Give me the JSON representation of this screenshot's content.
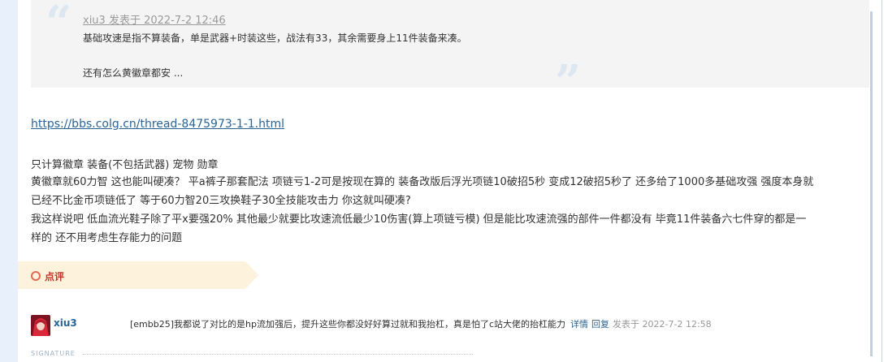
{
  "quote": {
    "author_line": "xiu3 发表于 2022-7-2 12:46",
    "lines": [
      "基础攻速是指不算装备，单是武器+时装这些，战法有33，其余需要身上11件装备来凑。",
      "还有怎么黄徽章都安 ..."
    ]
  },
  "post": {
    "link": "https://bbs.colg.cn/thread-8475973-1-1.html",
    "lines": [
      "只计算徽章 装备(不包括武器) 宠物 勋章",
      "黄徽章就60力智 这也能叫硬凑？ 平a裤子那套配法 项链亏1-2可是按现在算的 装备改版后浮光项链10破招5秒 变成12破招5秒了 还多给了1000多基础攻强 强度本身就",
      "已经不比金币项链低了 等于60力智20三攻换鞋子30全技能攻击力 你这就叫硬凑?",
      "我这样说吧 低血流光鞋子除了平x要强20% 其他最少就要比攻速流低最少10伤害(算上项链亏模) 但是能比攻速流强的部件一件都没有 毕竟11件装备六七件穿的都是一",
      "样的  还不用考虑生存能力的问题"
    ]
  },
  "comments": {
    "header": "点评",
    "items": [
      {
        "user": "xiu3",
        "text": "[embb25]我都说了对比的是hp流加强后，提升这些你都没好好算过就和我抬杠，真是怕了c站大佬的抬杠能力",
        "detail_link": "详情",
        "reply_link": "回复",
        "time": "发表于 2022-7-2 12:58"
      }
    ]
  },
  "signature": {
    "label": "SIGNATURE"
  },
  "colors": {
    "link": "#2a6496",
    "quote_bg": "#f4f4f4",
    "comment_tab_bg": "#fdf2dc",
    "comment_accent": "#c0392b"
  },
  "icons": {
    "quote_open": "“",
    "quote_close": "”",
    "comment": "circle-outline-icon"
  }
}
